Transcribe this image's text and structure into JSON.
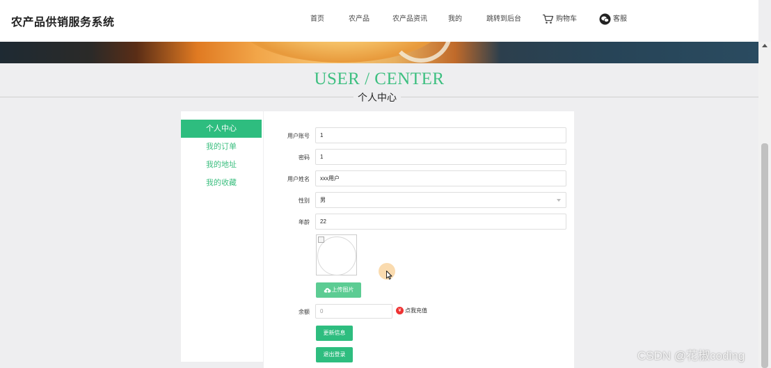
{
  "header": {
    "logo": "农产品供销服务系统",
    "nav": [
      {
        "label": "首页"
      },
      {
        "label": "农产品"
      },
      {
        "label": "农产品资讯"
      },
      {
        "label": "我的"
      },
      {
        "label": "跳转到后台"
      },
      {
        "label": "购物车",
        "icon": "cart-icon"
      },
      {
        "label": "客服",
        "icon": "chat-bubble-icon"
      }
    ]
  },
  "section": {
    "title_en": "USER / CENTER",
    "title_cn": "个人中心"
  },
  "sidebar": {
    "items": [
      {
        "label": "个人中心",
        "active": true
      },
      {
        "label": "我的订单",
        "active": false
      },
      {
        "label": "我的地址",
        "active": false
      },
      {
        "label": "我的收藏",
        "active": false
      }
    ]
  },
  "form": {
    "username": {
      "label": "用户账号",
      "value": "1"
    },
    "password": {
      "label": "密码",
      "value": "1"
    },
    "name": {
      "label": "用户姓名",
      "value": "xxx用户"
    },
    "gender": {
      "label": "性别",
      "value": "男"
    },
    "age": {
      "label": "年龄",
      "value": "22"
    },
    "upload_button": "上传图片",
    "balance": {
      "label": "余额",
      "placeholder": "0"
    },
    "recharge_link": "点我充值",
    "update_button": "更新信息",
    "logout_button": "退出登录"
  },
  "watermark": "CSDN @花椒coding",
  "colors": {
    "accent": "#2ebd7f",
    "accent_light": "#5ccc93",
    "title_green": "#3dbf80",
    "recharge_icon": "#e33333"
  }
}
